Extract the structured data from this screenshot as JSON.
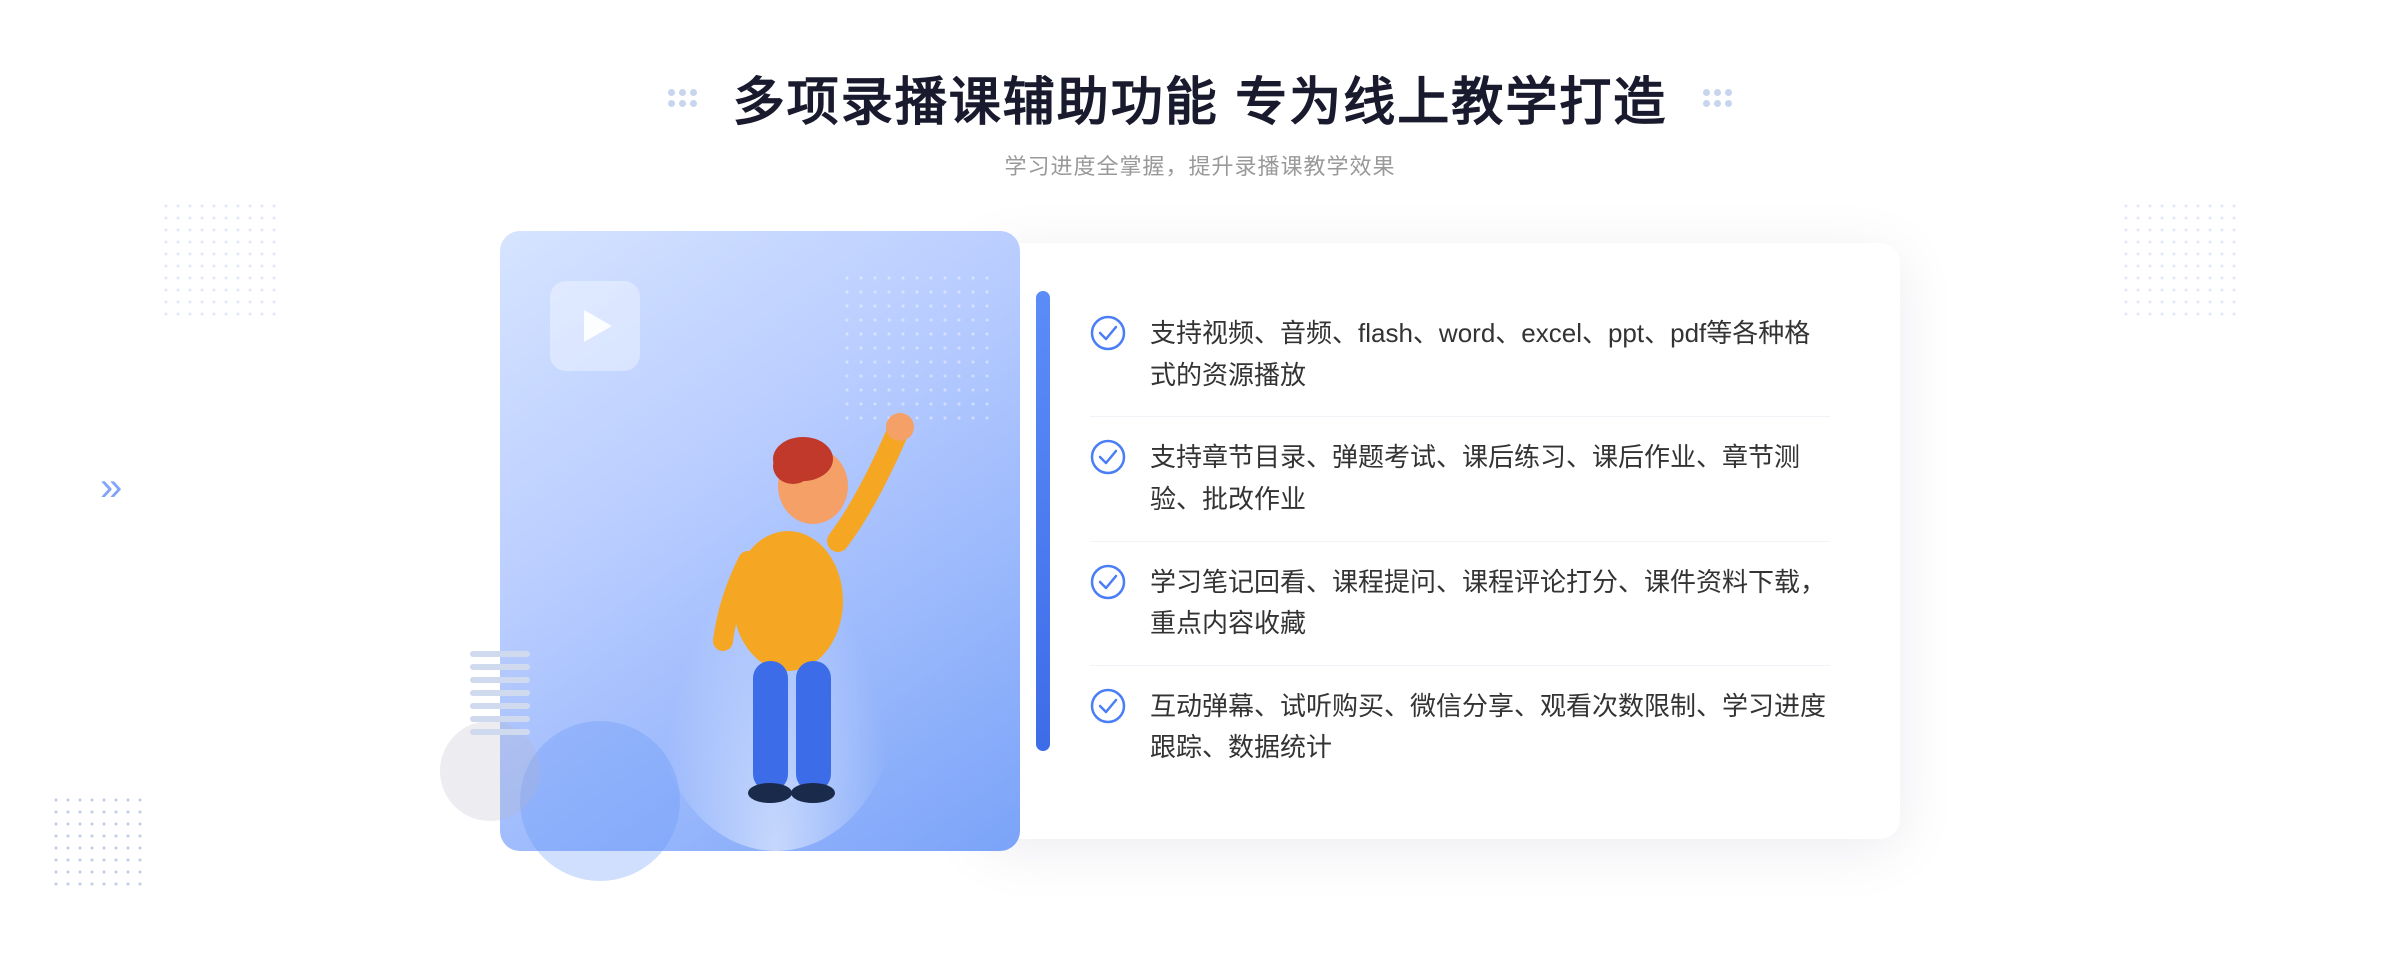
{
  "page": {
    "title": "多项录播课辅助功能 专为线上教学打造",
    "subtitle": "学习进度全掌握，提升录播课教学效果",
    "features": [
      {
        "id": "feature-1",
        "text": "支持视频、音频、flash、word、excel、ppt、pdf等各种格式的资源播放"
      },
      {
        "id": "feature-2",
        "text": "支持章节目录、弹题考试、课后练习、课后作业、章节测验、批改作业"
      },
      {
        "id": "feature-3",
        "text": "学习笔记回看、课程提问、课程评论打分、课件资料下载，重点内容收藏"
      },
      {
        "id": "feature-4",
        "text": "互动弹幕、试听购买、微信分享、观看次数限制、学习进度跟踪、数据统计"
      }
    ],
    "chevron_left": "»",
    "colors": {
      "primary": "#4a7ef7",
      "title": "#1a1a2e",
      "subtitle": "#999999",
      "feature_text": "#333333",
      "check_color": "#4a7ef7",
      "panel_bg": "#ffffff",
      "illus_bg_start": "#d6e4ff",
      "illus_bg_end": "#7aa3f8"
    }
  }
}
